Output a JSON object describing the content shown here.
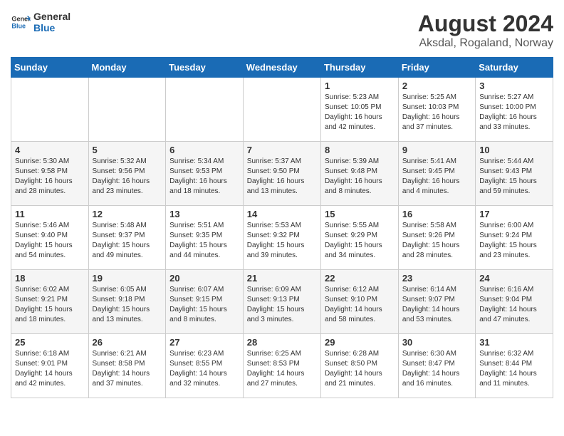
{
  "logo": {
    "line1": "General",
    "line2": "Blue"
  },
  "title": "August 2024",
  "subtitle": "Aksdal, Rogaland, Norway",
  "days_header": [
    "Sunday",
    "Monday",
    "Tuesday",
    "Wednesday",
    "Thursday",
    "Friday",
    "Saturday"
  ],
  "weeks": [
    [
      {
        "day": "",
        "info": ""
      },
      {
        "day": "",
        "info": ""
      },
      {
        "day": "",
        "info": ""
      },
      {
        "day": "",
        "info": ""
      },
      {
        "day": "1",
        "info": "Sunrise: 5:23 AM\nSunset: 10:05 PM\nDaylight: 16 hours and 42 minutes."
      },
      {
        "day": "2",
        "info": "Sunrise: 5:25 AM\nSunset: 10:03 PM\nDaylight: 16 hours and 37 minutes."
      },
      {
        "day": "3",
        "info": "Sunrise: 5:27 AM\nSunset: 10:00 PM\nDaylight: 16 hours and 33 minutes."
      }
    ],
    [
      {
        "day": "4",
        "info": "Sunrise: 5:30 AM\nSunset: 9:58 PM\nDaylight: 16 hours and 28 minutes."
      },
      {
        "day": "5",
        "info": "Sunrise: 5:32 AM\nSunset: 9:56 PM\nDaylight: 16 hours and 23 minutes."
      },
      {
        "day": "6",
        "info": "Sunrise: 5:34 AM\nSunset: 9:53 PM\nDaylight: 16 hours and 18 minutes."
      },
      {
        "day": "7",
        "info": "Sunrise: 5:37 AM\nSunset: 9:50 PM\nDaylight: 16 hours and 13 minutes."
      },
      {
        "day": "8",
        "info": "Sunrise: 5:39 AM\nSunset: 9:48 PM\nDaylight: 16 hours and 8 minutes."
      },
      {
        "day": "9",
        "info": "Sunrise: 5:41 AM\nSunset: 9:45 PM\nDaylight: 16 hours and 4 minutes."
      },
      {
        "day": "10",
        "info": "Sunrise: 5:44 AM\nSunset: 9:43 PM\nDaylight: 15 hours and 59 minutes."
      }
    ],
    [
      {
        "day": "11",
        "info": "Sunrise: 5:46 AM\nSunset: 9:40 PM\nDaylight: 15 hours and 54 minutes."
      },
      {
        "day": "12",
        "info": "Sunrise: 5:48 AM\nSunset: 9:37 PM\nDaylight: 15 hours and 49 minutes."
      },
      {
        "day": "13",
        "info": "Sunrise: 5:51 AM\nSunset: 9:35 PM\nDaylight: 15 hours and 44 minutes."
      },
      {
        "day": "14",
        "info": "Sunrise: 5:53 AM\nSunset: 9:32 PM\nDaylight: 15 hours and 39 minutes."
      },
      {
        "day": "15",
        "info": "Sunrise: 5:55 AM\nSunset: 9:29 PM\nDaylight: 15 hours and 34 minutes."
      },
      {
        "day": "16",
        "info": "Sunrise: 5:58 AM\nSunset: 9:26 PM\nDaylight: 15 hours and 28 minutes."
      },
      {
        "day": "17",
        "info": "Sunrise: 6:00 AM\nSunset: 9:24 PM\nDaylight: 15 hours and 23 minutes."
      }
    ],
    [
      {
        "day": "18",
        "info": "Sunrise: 6:02 AM\nSunset: 9:21 PM\nDaylight: 15 hours and 18 minutes."
      },
      {
        "day": "19",
        "info": "Sunrise: 6:05 AM\nSunset: 9:18 PM\nDaylight: 15 hours and 13 minutes."
      },
      {
        "day": "20",
        "info": "Sunrise: 6:07 AM\nSunset: 9:15 PM\nDaylight: 15 hours and 8 minutes."
      },
      {
        "day": "21",
        "info": "Sunrise: 6:09 AM\nSunset: 9:13 PM\nDaylight: 15 hours and 3 minutes."
      },
      {
        "day": "22",
        "info": "Sunrise: 6:12 AM\nSunset: 9:10 PM\nDaylight: 14 hours and 58 minutes."
      },
      {
        "day": "23",
        "info": "Sunrise: 6:14 AM\nSunset: 9:07 PM\nDaylight: 14 hours and 53 minutes."
      },
      {
        "day": "24",
        "info": "Sunrise: 6:16 AM\nSunset: 9:04 PM\nDaylight: 14 hours and 47 minutes."
      }
    ],
    [
      {
        "day": "25",
        "info": "Sunrise: 6:18 AM\nSunset: 9:01 PM\nDaylight: 14 hours and 42 minutes."
      },
      {
        "day": "26",
        "info": "Sunrise: 6:21 AM\nSunset: 8:58 PM\nDaylight: 14 hours and 37 minutes."
      },
      {
        "day": "27",
        "info": "Sunrise: 6:23 AM\nSunset: 8:55 PM\nDaylight: 14 hours and 32 minutes."
      },
      {
        "day": "28",
        "info": "Sunrise: 6:25 AM\nSunset: 8:53 PM\nDaylight: 14 hours and 27 minutes."
      },
      {
        "day": "29",
        "info": "Sunrise: 6:28 AM\nSunset: 8:50 PM\nDaylight: 14 hours and 21 minutes."
      },
      {
        "day": "30",
        "info": "Sunrise: 6:30 AM\nSunset: 8:47 PM\nDaylight: 14 hours and 16 minutes."
      },
      {
        "day": "31",
        "info": "Sunrise: 6:32 AM\nSunset: 8:44 PM\nDaylight: 14 hours and 11 minutes."
      }
    ]
  ]
}
